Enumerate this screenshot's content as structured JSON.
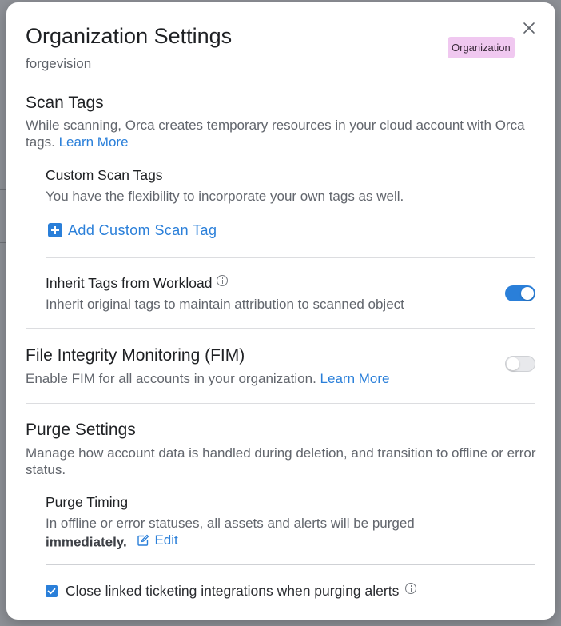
{
  "modal": {
    "title": "Organization Settings",
    "subtitle": "forgevision",
    "badge": "Organization"
  },
  "scan_tags": {
    "heading": "Scan Tags",
    "description": "While scanning, Orca creates temporary resources in your cloud account with Orca tags.",
    "learn_more": "Learn More",
    "custom": {
      "heading": "Custom Scan Tags",
      "description": "You have the flexibility to incorporate your own tags as well.",
      "add_label": "Add Custom Scan Tag"
    },
    "inherit": {
      "heading": "Inherit Tags from Workload",
      "description": "Inherit original tags to maintain attribution to scanned object",
      "enabled": true
    }
  },
  "fim": {
    "heading": "File Integrity Monitoring (FIM)",
    "description": "Enable FIM for all accounts in your organization.",
    "learn_more": "Learn More",
    "enabled": false
  },
  "purge": {
    "heading": "Purge Settings",
    "description": "Manage how account data is handled during deletion, and transition to offline or error status.",
    "timing": {
      "heading": "Purge Timing",
      "description": "In offline or error statuses, all assets and alerts will be purged",
      "value": "immediately.",
      "edit_label": "Edit"
    },
    "close_tickets": {
      "label": "Close linked ticketing integrations when purging alerts",
      "checked": true
    }
  },
  "colors": {
    "accent": "#2a7fd9",
    "badge_bg": "#f0c8f0"
  }
}
